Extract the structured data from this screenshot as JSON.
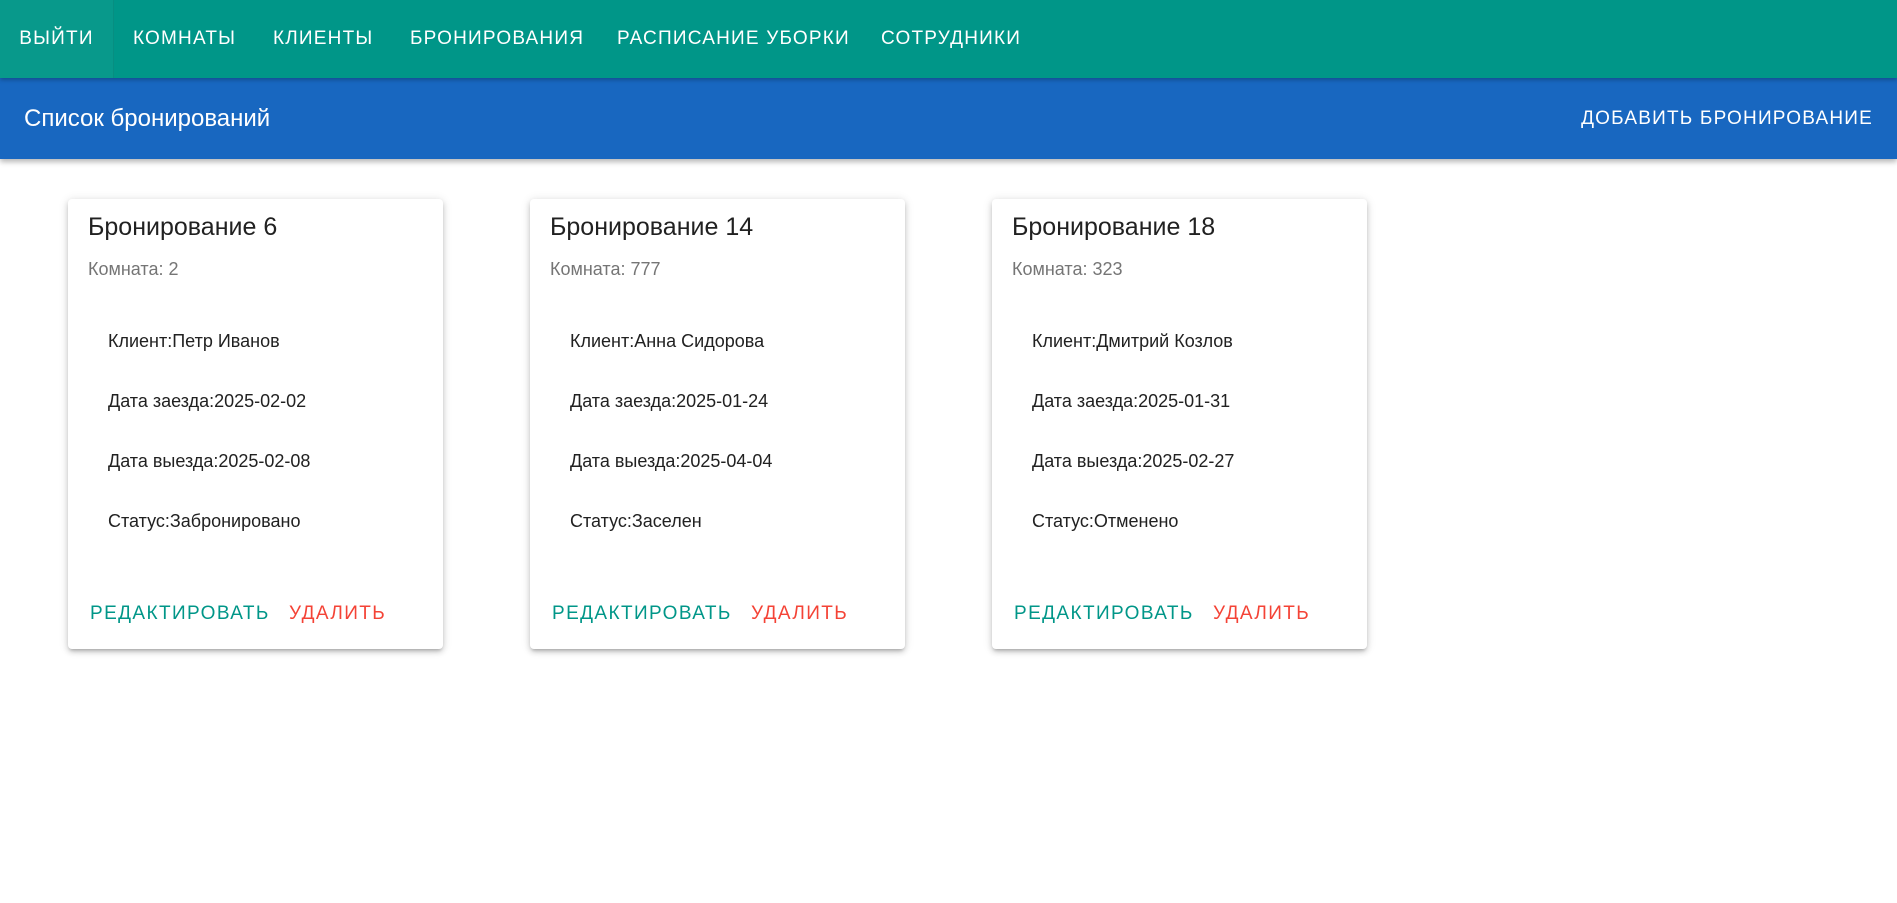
{
  "nav": {
    "items": [
      {
        "label": "ВЫЙТИ"
      },
      {
        "label": "КОМНАТЫ"
      },
      {
        "label": "КЛИЕНТЫ"
      },
      {
        "label": "БРОНИРОВАНИЯ"
      },
      {
        "label": "РАСПИСАНИЕ УБОРКИ"
      },
      {
        "label": "СОТРУДНИКИ"
      }
    ]
  },
  "header": {
    "title": "Список бронирований",
    "add_label": "ДОБАВИТЬ БРОНИРОВАНИЕ"
  },
  "bookings": [
    {
      "title": "Бронирование 6",
      "room": "Комната: 2",
      "client": "Клиент:Петр Иванов",
      "checkin": "Дата заезда:2025-02-02",
      "checkout": "Дата выезда:2025-02-08",
      "status": "Статус:Забронировано",
      "edit_label": "РЕДАКТИРОВАТЬ",
      "delete_label": "УДАЛИТЬ"
    },
    {
      "title": "Бронирование 14",
      "room": "Комната: 777",
      "client": "Клиент:Анна Сидорова",
      "checkin": "Дата заезда:2025-01-24",
      "checkout": "Дата выезда:2025-04-04",
      "status": "Статус:Заселен",
      "edit_label": "РЕДАКТИРОВАТЬ",
      "delete_label": "УДАЛИТЬ"
    },
    {
      "title": "Бронирование 18",
      "room": "Комната: 323",
      "client": "Клиент:Дмитрий Козлов",
      "checkin": "Дата заезда:2025-01-31",
      "checkout": "Дата выезда:2025-02-27",
      "status": "Статус:Отменено",
      "edit_label": "РЕДАКТИРОВАТЬ",
      "delete_label": "УДАЛИТЬ"
    }
  ],
  "colors": {
    "nav_bg": "#009688",
    "header_bg": "#1867c0",
    "edit": "#009688",
    "delete": "#f44336"
  }
}
